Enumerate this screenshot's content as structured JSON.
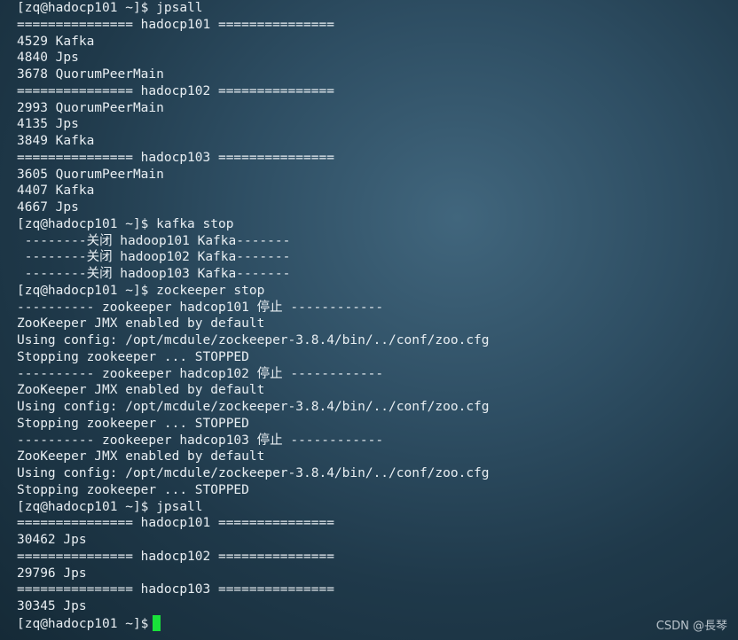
{
  "terminal": {
    "lines": [
      "[zq@hadocp101 ~]$ jpsall",
      "=============== hadocp101 ===============",
      "4529 Kafka",
      "4840 Jps",
      "3678 QuorumPeerMain",
      "=============== hadocp102 ===============",
      "2993 QuorumPeerMain",
      "4135 Jps",
      "3849 Kafka",
      "=============== hadocp103 ===============",
      "3605 QuorumPeerMain",
      "4407 Kafka",
      "4667 Jps",
      "[zq@hadocp101 ~]$ kafka stop",
      " --------关闭 hadoop101 Kafka-------",
      " --------关闭 hadoop102 Kafka-------",
      " --------关闭 hadoop103 Kafka-------",
      "[zq@hadocp101 ~]$ zockeeper stop",
      "---------- zookeeper hadcop101 停止 ------------",
      "ZooKeeper JMX enabled by default",
      "Using config: /opt/mcdule/zockeeper-3.8.4/bin/../conf/zoo.cfg",
      "Stopping zookeeper ... STOPPED",
      "---------- zookeeper hadcop102 停止 ------------",
      "ZooKeeper JMX enabled by default",
      "Using config: /opt/mcdule/zockeeper-3.8.4/bin/../conf/zoo.cfg",
      "Stopping zookeeper ... STOPPED",
      "---------- zookeeper hadcop103 停止 ------------",
      "ZooKeeper JMX enabled by default",
      "Using config: /opt/mcdule/zockeeper-3.8.4/bin/../conf/zoo.cfg",
      "Stopping zookeeper ... STOPPED",
      "[zq@hadocp101 ~]$ jpsall",
      "=============== hadocp101 ===============",
      "30462 Jps",
      "=============== hadocp102 ===============",
      "29796 Jps",
      "=============== hadocp103 ===============",
      "30345 Jps"
    ],
    "prompt": "[zq@hadocp101 ~]$",
    "cursor_color": "#19e23a",
    "text_color": "#e8eef2",
    "background_color": "#2e4e63"
  },
  "watermark": {
    "text": "CSDN @長琴"
  }
}
